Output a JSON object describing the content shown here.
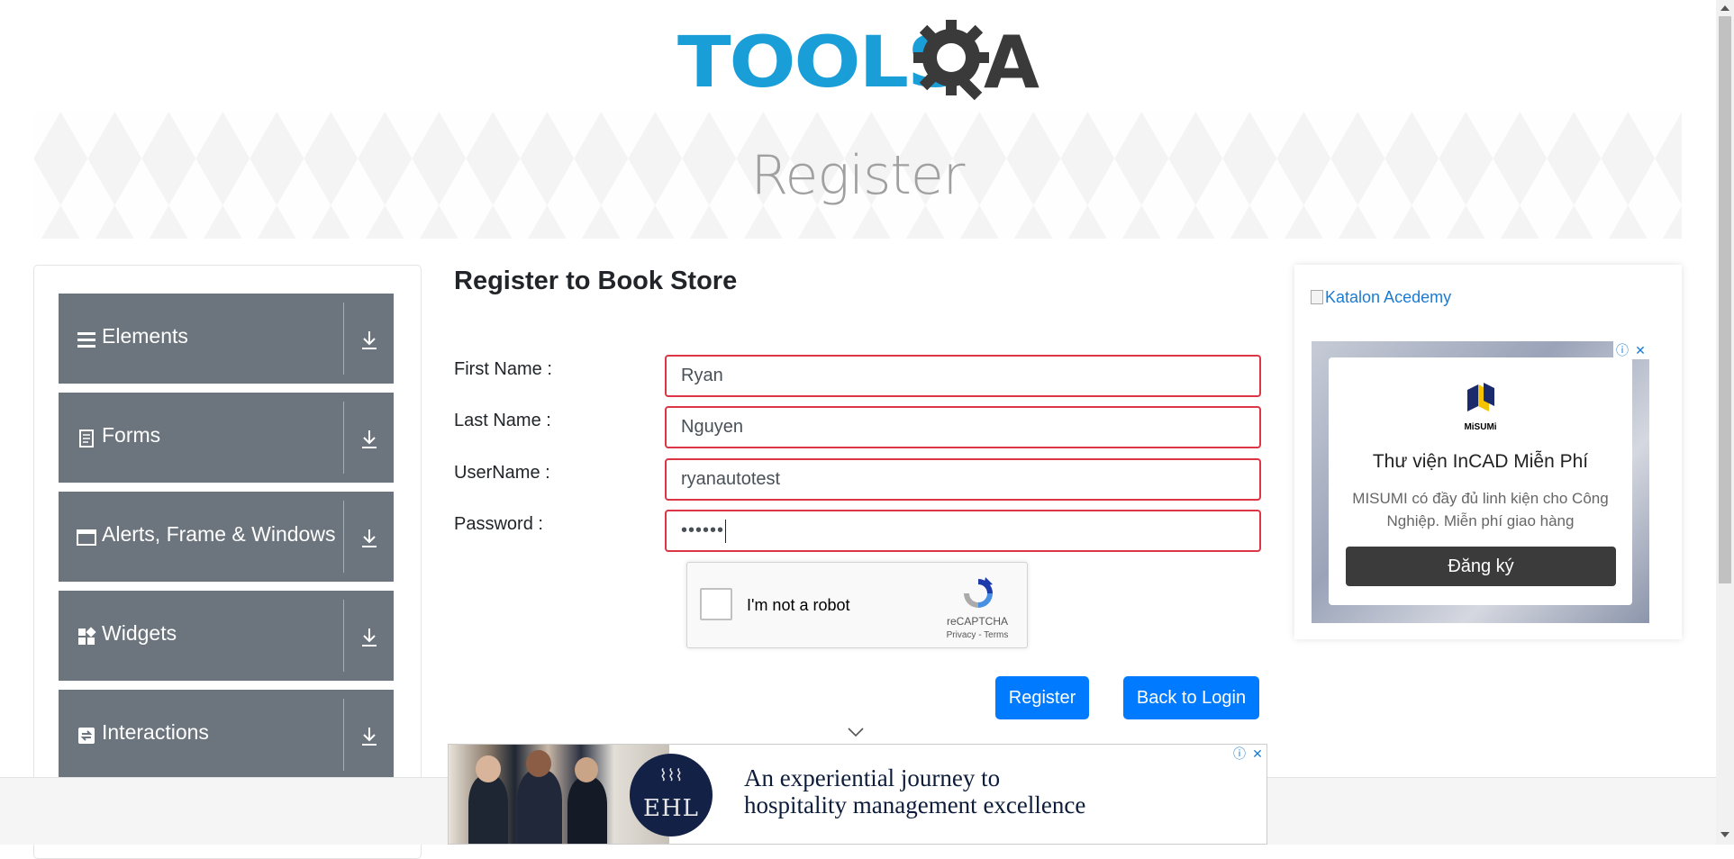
{
  "header": {
    "logo_main": "TOOLS",
    "logo_a": "A"
  },
  "banner": {
    "title": "Register"
  },
  "menu": {
    "items": [
      {
        "label": "Elements",
        "icon": "hamburger-icon"
      },
      {
        "label": "Forms",
        "icon": "document-icon"
      },
      {
        "label": "Alerts, Frame & Windows",
        "icon": "window-icon"
      },
      {
        "label": "Widgets",
        "icon": "widgets-icon"
      },
      {
        "label": "Interactions",
        "icon": "interactions-icon"
      }
    ]
  },
  "form": {
    "title": "Register to Book Store",
    "first_name": {
      "label": "First Name :",
      "value": "Ryan"
    },
    "last_name": {
      "label": "Last Name :",
      "value": "Nguyen"
    },
    "username": {
      "label": "UserName :",
      "value": "ryanautotest"
    },
    "password": {
      "label": "Password :",
      "value": "••••••"
    },
    "recaptcha": {
      "label": "I'm not a robot",
      "brand": "reCAPTCHA",
      "links": "Privacy - Terms"
    },
    "register_label": "Register",
    "back_label": "Back to Login"
  },
  "ad_right": {
    "katalon_alt": "Katalon Acedemy",
    "misumi_brand": "MiSUMi",
    "title": "Thư viện InCAD Miễn Phí",
    "description": "MISUMI có đầy đủ linh kiện cho Công Nghiệp. Miễn phí giao hàng",
    "button": "Đăng ký"
  },
  "ad_bottom": {
    "logo_text": "EHL",
    "tagline_line1": "An experiential journey to",
    "tagline_line2": "hospitality management excellence"
  },
  "colors": {
    "logo_blue": "#1a9ed8",
    "menu_bg": "#6c757d",
    "primary_button": "#007bff",
    "invalid_border": "#dc3545"
  }
}
